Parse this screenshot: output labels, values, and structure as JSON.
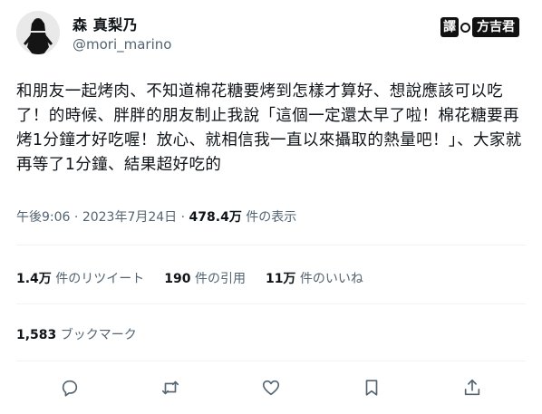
{
  "user": {
    "display_name": "森 真梨乃",
    "handle": "@mori_marino"
  },
  "translate_badge": {
    "label_translate": "譯",
    "translator_name": "方吉君"
  },
  "tweet": {
    "text": "和朋友一起烤肉、不知道棉花糖要烤到怎樣才算好、想說應該可以吃了！的時候、胖胖的朋友制止我說「這個一定還太早了啦！棉花糖要再烤1分鐘才好吃喔！放心、就相信我一直以來攝取的熱量吧！」、大家就再等了1分鐘、結果超好吃的"
  },
  "meta": {
    "time": "午後9:06",
    "separator": "·",
    "date": "2023年7月24日",
    "views_count": "478.4万",
    "views_label": "件の表示"
  },
  "stats": {
    "retweets_count": "1.4万",
    "retweets_label": "件のリツイート",
    "quotes_count": "190",
    "quotes_label": "件の引用",
    "likes_count": "11万",
    "likes_label": "件のいいね",
    "bookmarks_count": "1,583",
    "bookmarks_label": "ブックマーク"
  },
  "actions": [
    {
      "icon": "reply-icon"
    },
    {
      "icon": "retweet-icon"
    },
    {
      "icon": "like-icon"
    },
    {
      "icon": "bookmark-icon"
    },
    {
      "icon": "share-icon"
    }
  ],
  "colors": {
    "text_primary": "#0f1419",
    "text_secondary": "#536471",
    "divider": "#eff3f4"
  }
}
